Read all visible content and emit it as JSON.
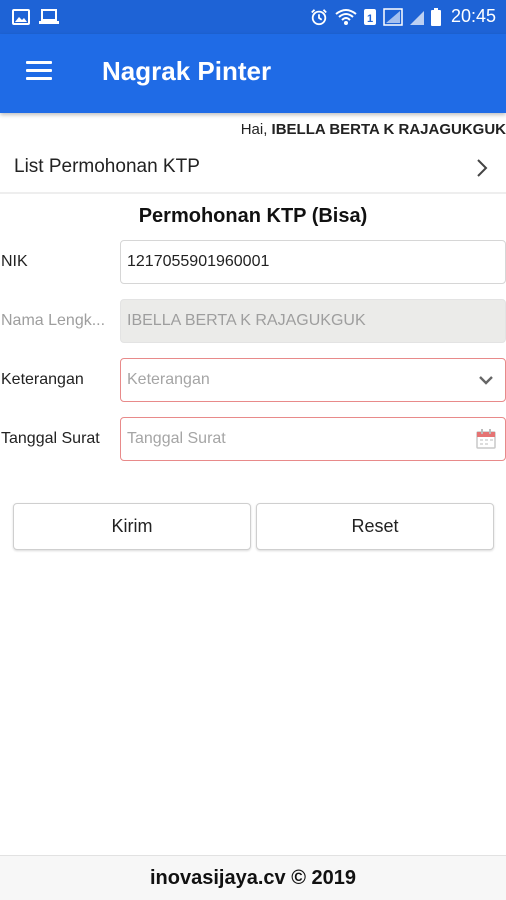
{
  "status_bar": {
    "time": "20:45",
    "icons": [
      "image-icon",
      "laptop-icon",
      "alarm-icon",
      "wifi-icon",
      "data-icon",
      "signal-icon",
      "signal-icon",
      "battery-icon"
    ]
  },
  "app_bar": {
    "title": "Nagrak Pinter",
    "menu_icon": "hamburger-menu-icon"
  },
  "greeting": {
    "prefix": "Hai, ",
    "user": "IBELLA BERTA K RAJAGUKGUK"
  },
  "list_link": {
    "label": "List Permohonan KTP",
    "icon": "chevron-right-icon"
  },
  "form": {
    "title": "Permohonan KTP (Bisa)",
    "fields": [
      {
        "label": "NIK",
        "value": "1217055901960001",
        "placeholder": ""
      },
      {
        "label": "Nama Lengk...",
        "value": "IBELLA BERTA K RAJAGUKGUK",
        "placeholder": ""
      },
      {
        "label": "Keterangan",
        "value": "",
        "placeholder": "Keterangan"
      },
      {
        "label": "Tanggal Surat",
        "value": "",
        "placeholder": "Tanggal Surat"
      }
    ]
  },
  "buttons": {
    "submit": "Kirim",
    "reset": "Reset"
  },
  "footer": {
    "text": "inovasijaya.cv © 2019"
  },
  "colors": {
    "app_bar": "#1f6be6",
    "status_bar": "#1e63d6",
    "invalid_border": "#e88a8a",
    "readonly_bg": "#ebebe9"
  }
}
